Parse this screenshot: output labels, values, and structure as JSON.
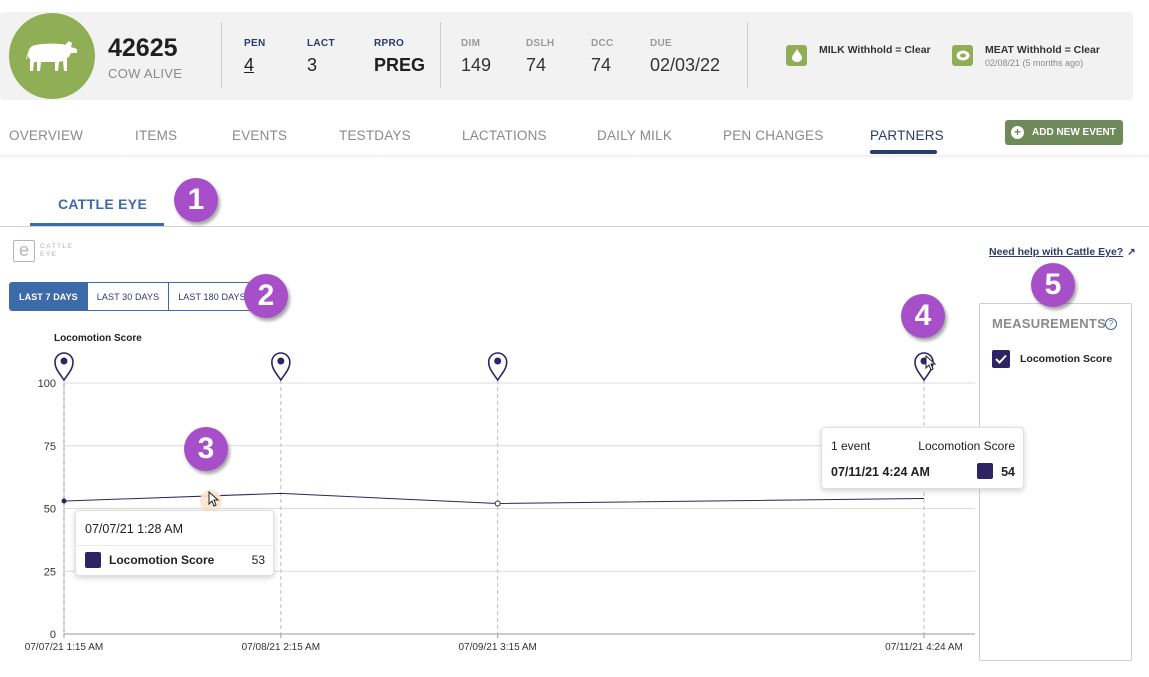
{
  "cow": {
    "id": "42625",
    "status": "COW ALIVE",
    "stats": [
      {
        "label": "PEN",
        "value": "4"
      },
      {
        "label": "LACT",
        "value": "3"
      },
      {
        "label": "RPRO",
        "value": "PREG"
      },
      {
        "label": "DIM",
        "value": "149"
      },
      {
        "label": "DSLH",
        "value": "74"
      },
      {
        "label": "DCC",
        "value": "74"
      },
      {
        "label": "DUE",
        "value": "02/03/22"
      }
    ],
    "milk_withhold": "MILK Withhold = Clear",
    "meat_withhold": "MEAT Withhold = Clear",
    "meat_withhold_sub": "02/08/21 (5 months ago)"
  },
  "nav": {
    "tabs": [
      "OVERVIEW",
      "ITEMS",
      "EVENTS",
      "TESTDAYS",
      "LACTATIONS",
      "DAILY MILK",
      "PEN CHANGES",
      "PARTNERS"
    ],
    "active": "PARTNERS",
    "add_event": "ADD NEW EVENT"
  },
  "subtab": "CATTLE EYE",
  "logo_text": "CATTLE EYE",
  "help_link": "Need help with Cattle Eye?",
  "range_buttons": [
    "LAST 7 DAYS",
    "LAST 30 DAYS",
    "LAST 180 DAYS"
  ],
  "active_range": "LAST 7 DAYS",
  "badges": [
    "1",
    "2",
    "3",
    "4",
    "5"
  ],
  "measurements": {
    "title": "MEASUREMENTS",
    "help": "?",
    "items": [
      {
        "label": "Locomotion Score",
        "checked": true
      }
    ]
  },
  "chart_data": {
    "type": "line",
    "title": "Locomotion Score",
    "ylim": [
      0,
      100
    ],
    "yticks": [
      0,
      25,
      50,
      75,
      100
    ],
    "x_ticks": [
      "07/07/21 1:15 AM",
      "07/08/21 2:15 AM",
      "07/09/21 3:15 AM",
      "07/11/21 4:24 AM"
    ],
    "x_range": [
      "2021-07-07T01:15",
      "2021-07-11T04:24"
    ],
    "event_markers": [
      "2021-07-07T01:15",
      "2021-07-08T02:15",
      "2021-07-09T03:15",
      "2021-07-11T04:24"
    ],
    "series": [
      {
        "name": "Locomotion Score",
        "color": "#2e2464",
        "points": [
          {
            "x": "2021-07-07T01:15",
            "y": 53
          },
          {
            "x": "2021-07-07T01:28",
            "y": 53
          },
          {
            "x": "2021-07-08T02:15",
            "y": 56
          },
          {
            "x": "2021-07-09T03:15",
            "y": 52
          },
          {
            "x": "2021-07-11T04:24",
            "y": 54
          }
        ]
      }
    ],
    "grid": true
  },
  "tooltip_left": {
    "date": "07/07/21 1:28 AM",
    "name": "Locomotion Score",
    "value": "53"
  },
  "tooltip_right": {
    "count": "1 event",
    "name": "Locomotion Score",
    "date": "07/11/21 4:24 AM",
    "value": "54"
  },
  "colors": {
    "accent": "#3d6aa8",
    "navy": "#2a3a6a",
    "series": "#2e2464",
    "green": "#8fae55",
    "badge": "#a64fc9"
  }
}
